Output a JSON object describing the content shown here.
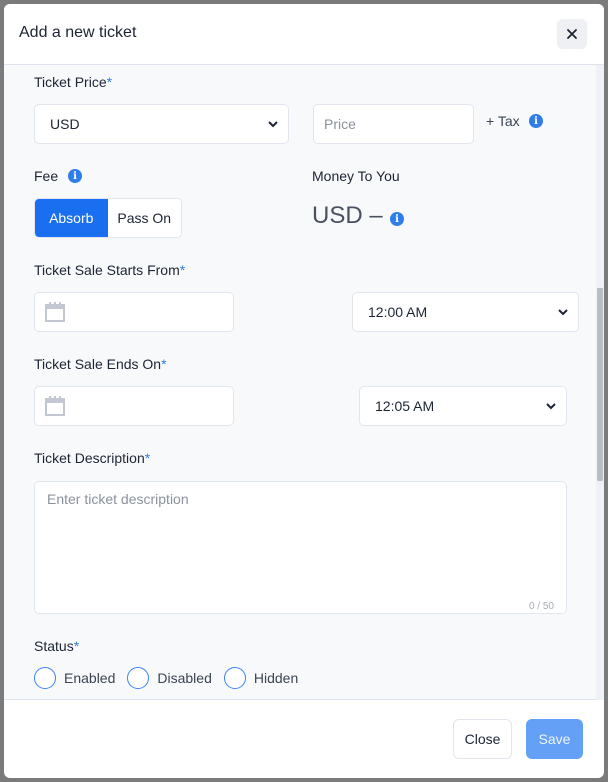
{
  "modal": {
    "title": "Add a new ticket",
    "close_icon": "close-icon"
  },
  "ticket_price": {
    "label": "Ticket Price",
    "required_mark": "*",
    "currency_value": "USD",
    "price_placeholder": "Price",
    "tax_label": "+ Tax",
    "info_icon": "info-icon"
  },
  "fee": {
    "label": "Fee",
    "info_icon": "info-icon",
    "options": [
      {
        "label": "Absorb",
        "active": true
      },
      {
        "label": "Pass On",
        "active": false
      }
    ]
  },
  "money_to_you": {
    "label": "Money To You",
    "value": "USD –",
    "info_icon": "info-icon"
  },
  "sale_start": {
    "label": "Ticket Sale Starts From",
    "required_mark": "*",
    "date_value": "",
    "time_value": "12:00 AM",
    "calendar_icon": "calendar-icon"
  },
  "sale_end": {
    "label": "Ticket Sale Ends On",
    "required_mark": "*",
    "date_value": "",
    "time_value": "12:05 AM",
    "calendar_icon": "calendar-icon"
  },
  "description": {
    "label": "Ticket Description",
    "required_mark": "*",
    "placeholder": "Enter ticket description",
    "value": "",
    "counter": "0 / 50"
  },
  "status": {
    "label": "Status",
    "required_mark": "*",
    "options": [
      {
        "label": "Enabled",
        "checked": false
      },
      {
        "label": "Disabled",
        "checked": false
      },
      {
        "label": "Hidden",
        "checked": false
      }
    ]
  },
  "footer": {
    "close_label": "Close",
    "save_label": "Save"
  },
  "colors": {
    "accent": "#1a6ff0",
    "save_disabled": "#64a0f5",
    "required": "#2f7de6"
  }
}
